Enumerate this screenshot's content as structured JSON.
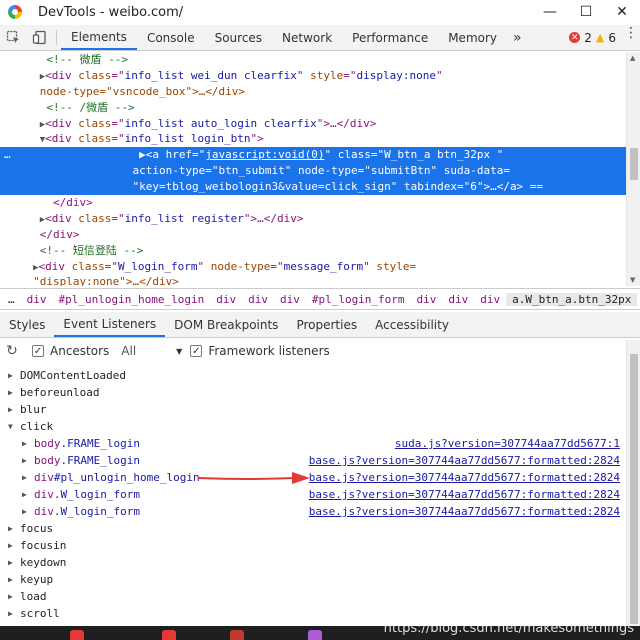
{
  "window": {
    "title": "DevTools - weibo.com/",
    "controls": {
      "minimize": "—",
      "maximize": "☐",
      "close": "✕"
    }
  },
  "toolbar": {
    "inspect_icon": "inspect-element-icon",
    "device_icon": "device-toolbar-icon",
    "tabs": [
      "Elements",
      "Console",
      "Sources",
      "Network",
      "Performance",
      "Memory"
    ],
    "active_tab": "Elements",
    "more": "»",
    "error_count": "2",
    "warning_count": "6",
    "kebab": "⋮"
  },
  "tree": {
    "lines": [
      {
        "indent": "       ",
        "comment": "<!-- 微盾 -->"
      },
      {
        "indent": "      ",
        "arrow": "▶",
        "tag": "<div ",
        "attrs": [
          [
            "class",
            "info_list wei_dun clearfix"
          ],
          [
            "style",
            "display:none"
          ]
        ],
        "wrap": "node-type=\"vsncode_box\">…</div>"
      },
      {
        "indent": "       ",
        "comment": "<!-- /微盾 -->"
      },
      {
        "indent": "      ",
        "arrow": "▶",
        "tag": "<div ",
        "attrs": [
          [
            "class",
            "info_list auto_login clearfix"
          ]
        ],
        "tail": ">…</div>"
      },
      {
        "indent": "      ",
        "arrow": "▼",
        "tag": "<div ",
        "attrs": [
          [
            "class",
            "info_list login_btn"
          ]
        ],
        "tail": ">"
      }
    ],
    "selected": {
      "dots": "…",
      "line1_pre": "▶<a href=\"",
      "href": "javascript:void(0)",
      "line1_post": "\" class=\"W_btn_a btn_32px \"",
      "line2": "action-type=\"btn_submit\" node-type=\"submitBtn\" suda-data=",
      "line3": "\"key=tblog_weibologin3&value=click_sign\" tabindex=\"6\">…</a> =="
    },
    "after": [
      {
        "indent": "        ",
        "text": "</div>"
      },
      {
        "indent": "      ",
        "arrow": "▶",
        "tag": "<div ",
        "attrs": [
          [
            "class",
            "info_list register"
          ]
        ],
        "tail": ">…</div>"
      },
      {
        "indent": "      ",
        "text": "</div>"
      },
      {
        "indent": "      ",
        "comment": "<!-- 短信登陆 -->"
      },
      {
        "indent": "     ",
        "arrow": "▶",
        "tag": "<div ",
        "attrs": [
          [
            "class",
            "W_login_form"
          ],
          [
            "node-type",
            "message_form"
          ]
        ],
        "wrap": "\"display:none\">…</div>",
        "trail": " style="
      }
    ]
  },
  "breadcrumb": {
    "dots": "…",
    "items": [
      "div",
      "#pl_unlogin_home_login",
      "div",
      "div",
      "div",
      "#pl_login_form",
      "div",
      "div",
      "div"
    ],
    "current": "a.W_btn_a.btn_32px"
  },
  "subtabs": {
    "items": [
      "Styles",
      "Event Listeners",
      "DOM Breakpoints",
      "Properties",
      "Accessibility"
    ],
    "active": "Event Listeners"
  },
  "filter": {
    "refresh_icon": "refresh-icon",
    "ancestors_label": "Ancestors",
    "ancestors_checked": true,
    "select_value": "All",
    "framework_label": "Framework listeners",
    "framework_checked": true
  },
  "listeners": {
    "events": [
      {
        "name": "DOMContentLoaded",
        "expanded": false
      },
      {
        "name": "beforeunload",
        "expanded": false
      },
      {
        "name": "blur",
        "expanded": false
      },
      {
        "name": "click",
        "expanded": true,
        "children": [
          {
            "tag": "body",
            "cls": ".FRAME_login",
            "source": "suda.js?version=307744aa77dd5677:1"
          },
          {
            "tag": "body",
            "cls": ".FRAME_login",
            "source": "base.js?version=307744aa77dd5677:formatted:2824"
          },
          {
            "tag": "div",
            "cls": "#pl_unlogin_home_login",
            "source": "base.js?version=307744aa77dd5677:formatted:2824"
          },
          {
            "tag": "div",
            "cls": ".W_login_form",
            "source": "base.js?version=307744aa77dd5677:formatted:2824"
          },
          {
            "tag": "div",
            "cls": ".W_login_form",
            "source": "base.js?version=307744aa77dd5677:formatted:2824"
          }
        ]
      },
      {
        "name": "focus",
        "expanded": false
      },
      {
        "name": "focusin",
        "expanded": false
      },
      {
        "name": "keydown",
        "expanded": false
      },
      {
        "name": "keyup",
        "expanded": false
      },
      {
        "name": "load",
        "expanded": false
      },
      {
        "name": "scroll",
        "expanded": false
      }
    ]
  },
  "annotation": {
    "arrow_color": "#e53935"
  },
  "watermark": "https://blog.csdn.net/makesomethings",
  "colors": {
    "accent": "#1a73e8",
    "selection": "#1a73e8",
    "tag": "#881280",
    "attr_name": "#994500",
    "attr_value": "#1a1aa6",
    "comment": "#236e25"
  }
}
